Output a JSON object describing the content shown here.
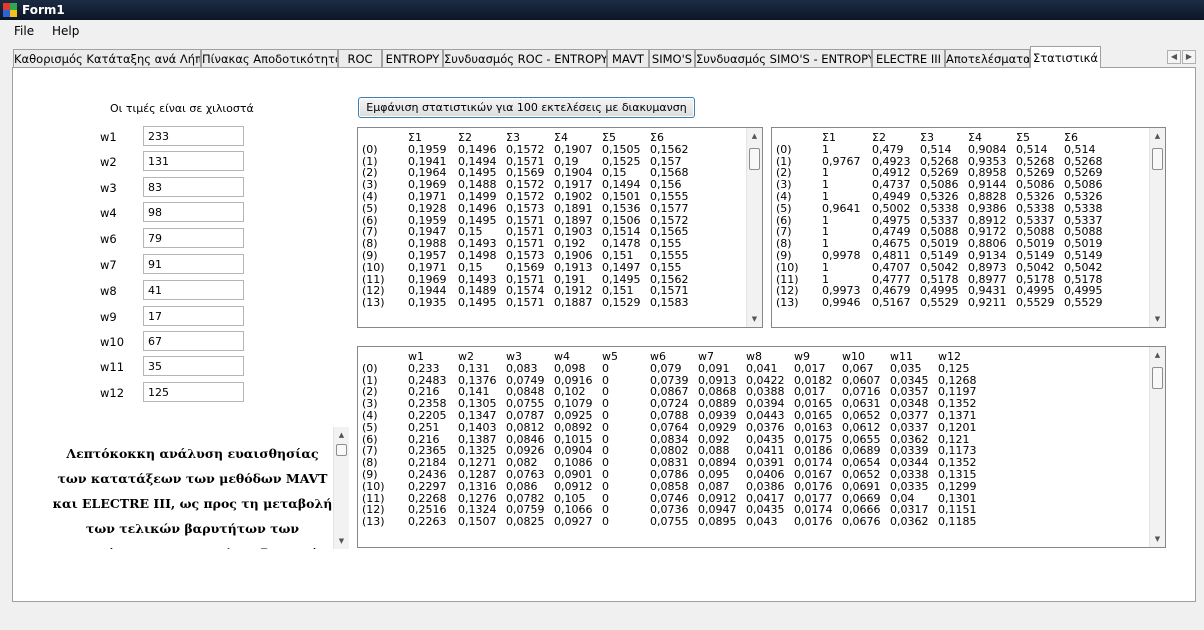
{
  "window": {
    "title": "Form1"
  },
  "menu": [
    "File",
    "Help"
  ],
  "tabs": [
    {
      "label": "Καθορισμός Κατάταξης ανά Λήπτη",
      "active": false
    },
    {
      "label": "Πίνακας Αποδοτικότητας",
      "active": false
    },
    {
      "label": "ROC",
      "active": false
    },
    {
      "label": "ENTROPY",
      "active": false
    },
    {
      "label": "Συνδυασμός ROC - ENTROPY",
      "active": false
    },
    {
      "label": "MAVT",
      "active": false
    },
    {
      "label": "SIMO'S",
      "active": false
    },
    {
      "label": "Συνδυασμός SIMO'S - ENTROPY",
      "active": false
    },
    {
      "label": "ELECTRE III",
      "active": false
    },
    {
      "label": "Αποτελέσματα",
      "active": false
    },
    {
      "label": "Στατιστικά",
      "active": true
    }
  ],
  "stats": {
    "note": "Οι τιμές είναι σε χιλιοστά",
    "button_label": "Εμφάνιση στατιστικών για 100 εκτελέσεις με διακυμανση",
    "description": "Λεπτόκοκκη ανάλυση ευαισθησίας των κατατάξεων των μεθόδων MAVT και ELECTRE III, ως προς τη μεταβολή των τελικών βαρυτήτων των κριτηρίων - Στατιστική επεξεργασία αποτελεσμάτων",
    "weights": [
      {
        "label": "w1",
        "value": "233"
      },
      {
        "label": "w2",
        "value": "131"
      },
      {
        "label": "w3",
        "value": "83"
      },
      {
        "label": "w4",
        "value": "98"
      },
      {
        "label": "w6",
        "value": "79"
      },
      {
        "label": "w7",
        "value": "91"
      },
      {
        "label": "w8",
        "value": "41"
      },
      {
        "label": "w9",
        "value": "17"
      },
      {
        "label": "w10",
        "value": "67"
      },
      {
        "label": "w11",
        "value": "35"
      },
      {
        "label": "w12",
        "value": "125"
      }
    ]
  },
  "list_left": {
    "headers": [
      "",
      "Σ1",
      "Σ2",
      "Σ3",
      "Σ4",
      "Σ5",
      "Σ6"
    ],
    "rows": [
      [
        "(0)",
        "0,1959",
        "0,1496",
        "0,1572",
        "0,1907",
        "0,1505",
        "0,1562"
      ],
      [
        "(1)",
        "0,1941",
        "0,1494",
        "0,1571",
        "0,19",
        "0,1525",
        "0,157"
      ],
      [
        "(2)",
        "0,1964",
        "0,1495",
        "0,1569",
        "0,1904",
        "0,15",
        "0,1568"
      ],
      [
        "(3)",
        "0,1969",
        "0,1488",
        "0,1572",
        "0,1917",
        "0,1494",
        "0,156"
      ],
      [
        "(4)",
        "0,1971",
        "0,1499",
        "0,1572",
        "0,1902",
        "0,1501",
        "0,1555"
      ],
      [
        "(5)",
        "0,1928",
        "0,1496",
        "0,1573",
        "0,1891",
        "0,1536",
        "0,1577"
      ],
      [
        "(6)",
        "0,1959",
        "0,1495",
        "0,1571",
        "0,1897",
        "0,1506",
        "0,1572"
      ],
      [
        "(7)",
        "0,1947",
        "0,15",
        "0,1571",
        "0,1903",
        "0,1514",
        "0,1565"
      ],
      [
        "(8)",
        "0,1988",
        "0,1493",
        "0,1571",
        "0,192",
        "0,1478",
        "0,155"
      ],
      [
        "(9)",
        "0,1957",
        "0,1498",
        "0,1573",
        "0,1906",
        "0,151",
        "0,1555"
      ],
      [
        "(10)",
        "0,1971",
        "0,15",
        "0,1569",
        "0,1913",
        "0,1497",
        "0,155"
      ],
      [
        "(11)",
        "0,1969",
        "0,1493",
        "0,1571",
        "0,191",
        "0,1495",
        "0,1562"
      ],
      [
        "(12)",
        "0,1944",
        "0,1489",
        "0,1574",
        "0,1912",
        "0,151",
        "0,1571"
      ],
      [
        "(13)",
        "0,1935",
        "0,1495",
        "0,1571",
        "0,1887",
        "0,1529",
        "0,1583"
      ]
    ]
  },
  "list_right": {
    "headers": [
      "",
      "Σ1",
      "Σ2",
      "Σ3",
      "Σ4",
      "Σ5",
      "Σ6"
    ],
    "rows": [
      [
        "(0)",
        "1",
        "0,479",
        "0,514",
        "0,9084",
        "0,514",
        "0,514"
      ],
      [
        "(1)",
        "0,9767",
        "0,4923",
        "0,5268",
        "0,9353",
        "0,5268",
        "0,5268"
      ],
      [
        "(2)",
        "1",
        "0,4912",
        "0,5269",
        "0,8958",
        "0,5269",
        "0,5269"
      ],
      [
        "(3)",
        "1",
        "0,4737",
        "0,5086",
        "0,9144",
        "0,5086",
        "0,5086"
      ],
      [
        "(4)",
        "1",
        "0,4949",
        "0,5326",
        "0,8828",
        "0,5326",
        "0,5326"
      ],
      [
        "(5)",
        "0,9641",
        "0,5002",
        "0,5338",
        "0,9386",
        "0,5338",
        "0,5338"
      ],
      [
        "(6)",
        "1",
        "0,4975",
        "0,5337",
        "0,8912",
        "0,5337",
        "0,5337"
      ],
      [
        "(7)",
        "1",
        "0,4749",
        "0,5088",
        "0,9172",
        "0,5088",
        "0,5088"
      ],
      [
        "(8)",
        "1",
        "0,4675",
        "0,5019",
        "0,8806",
        "0,5019",
        "0,5019"
      ],
      [
        "(9)",
        "0,9978",
        "0,4811",
        "0,5149",
        "0,9134",
        "0,5149",
        "0,5149"
      ],
      [
        "(10)",
        "1",
        "0,4707",
        "0,5042",
        "0,8973",
        "0,5042",
        "0,5042"
      ],
      [
        "(11)",
        "1",
        "0,4777",
        "0,5178",
        "0,8977",
        "0,5178",
        "0,5178"
      ],
      [
        "(12)",
        "0,9973",
        "0,4679",
        "0,4995",
        "0,9431",
        "0,4995",
        "0,4995"
      ],
      [
        "(13)",
        "0,9946",
        "0,5167",
        "0,5529",
        "0,9211",
        "0,5529",
        "0,5529"
      ]
    ]
  },
  "list_bottom": {
    "headers": [
      "",
      "w1",
      "w2",
      "w3",
      "w4",
      "w5",
      "w6",
      "w7",
      "w8",
      "w9",
      "w10",
      "w11",
      "w12"
    ],
    "rows": [
      [
        "(0)",
        "0,233",
        "0,131",
        "0,083",
        "0,098",
        "0",
        "0,079",
        "0,091",
        "0,041",
        "0,017",
        "0,067",
        "0,035",
        "0,125"
      ],
      [
        "(1)",
        "0,2483",
        "0,1376",
        "0,0749",
        "0,0916",
        "0",
        "0,0739",
        "0,0913",
        "0,0422",
        "0,0182",
        "0,0607",
        "0,0345",
        "0,1268"
      ],
      [
        "(2)",
        "0,216",
        "0,141",
        "0,0848",
        "0,102",
        "0",
        "0,0867",
        "0,0868",
        "0,0388",
        "0,017",
        "0,0716",
        "0,0357",
        "0,1197"
      ],
      [
        "(3)",
        "0,2358",
        "0,1305",
        "0,0755",
        "0,1079",
        "0",
        "0,0724",
        "0,0889",
        "0,0394",
        "0,0165",
        "0,0631",
        "0,0348",
        "0,1352"
      ],
      [
        "(4)",
        "0,2205",
        "0,1347",
        "0,0787",
        "0,0925",
        "0",
        "0,0788",
        "0,0939",
        "0,0443",
        "0,0165",
        "0,0652",
        "0,0377",
        "0,1371"
      ],
      [
        "(5)",
        "0,251",
        "0,1403",
        "0,0812",
        "0,0892",
        "0",
        "0,0764",
        "0,0929",
        "0,0376",
        "0,0163",
        "0,0612",
        "0,0337",
        "0,1201"
      ],
      [
        "(6)",
        "0,216",
        "0,1387",
        "0,0846",
        "0,1015",
        "0",
        "0,0834",
        "0,092",
        "0,0435",
        "0,0175",
        "0,0655",
        "0,0362",
        "0,121"
      ],
      [
        "(7)",
        "0,2365",
        "0,1325",
        "0,0926",
        "0,0904",
        "0",
        "0,0802",
        "0,088",
        "0,0411",
        "0,0186",
        "0,0689",
        "0,0339",
        "0,1173"
      ],
      [
        "(8)",
        "0,2184",
        "0,1271",
        "0,082",
        "0,1086",
        "0",
        "0,0831",
        "0,0894",
        "0,0391",
        "0,0174",
        "0,0654",
        "0,0344",
        "0,1352"
      ],
      [
        "(9)",
        "0,2436",
        "0,1287",
        "0,0763",
        "0,0901",
        "0",
        "0,0786",
        "0,095",
        "0,0406",
        "0,0167",
        "0,0652",
        "0,0338",
        "0,1315"
      ],
      [
        "(10)",
        "0,2297",
        "0,1316",
        "0,086",
        "0,0912",
        "0",
        "0,0858",
        "0,087",
        "0,0386",
        "0,0176",
        "0,0691",
        "0,0335",
        "0,1299"
      ],
      [
        "(11)",
        "0,2268",
        "0,1276",
        "0,0782",
        "0,105",
        "0",
        "0,0746",
        "0,0912",
        "0,0417",
        "0,0177",
        "0,0669",
        "0,04",
        "0,1301"
      ],
      [
        "(12)",
        "0,2516",
        "0,1324",
        "0,0759",
        "0,1066",
        "0",
        "0,0736",
        "0,0947",
        "0,0435",
        "0,0174",
        "0,0666",
        "0,0317",
        "0,1151"
      ],
      [
        "(13)",
        "0,2263",
        "0,1507",
        "0,0825",
        "0,0927",
        "0",
        "0,0755",
        "0,0895",
        "0,043",
        "0,0176",
        "0,0676",
        "0,0362",
        "0,1185"
      ]
    ]
  }
}
